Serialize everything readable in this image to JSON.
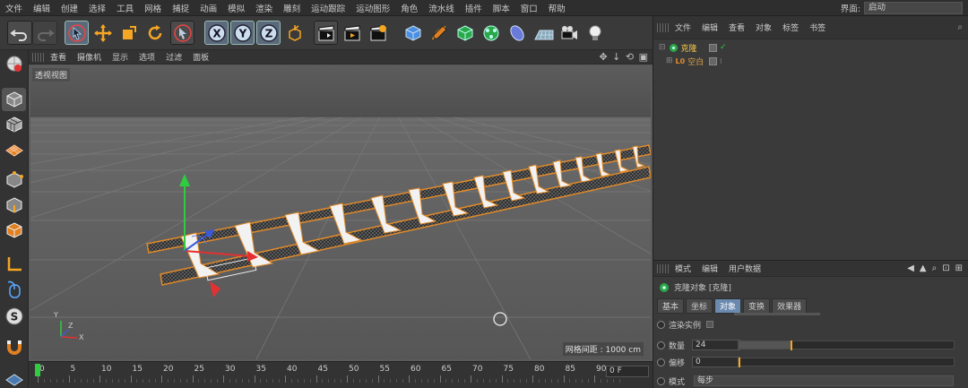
{
  "menu": {
    "items": [
      "文件",
      "编辑",
      "创建",
      "选择",
      "工具",
      "网格",
      "捕捉",
      "动画",
      "模拟",
      "渲染",
      "雕刻",
      "运动跟踪",
      "运动图形",
      "角色",
      "流水线",
      "插件",
      "脚本",
      "窗口",
      "帮助"
    ],
    "layout_label": "界面:",
    "layout_value": "启动"
  },
  "viewport": {
    "menu": [
      "查看",
      "摄像机",
      "显示",
      "选项",
      "过滤",
      "面板"
    ],
    "nav_icons": "✥ ↓ ⟲ ▣",
    "label": "透视视图",
    "grid_spacing": "网格间距 : 1000 cm",
    "axis_x": "X",
    "axis_y": "Y",
    "axis_z": "Z"
  },
  "timeline": {
    "ticks": [
      "0",
      "5",
      "10",
      "15",
      "20",
      "25",
      "30",
      "35",
      "40",
      "45",
      "50",
      "55",
      "60",
      "65",
      "70",
      "75",
      "80",
      "85",
      "90"
    ],
    "frame": "0 F"
  },
  "object_manager": {
    "menu": [
      "文件",
      "编辑",
      "查看",
      "对象",
      "标签",
      "书签"
    ],
    "objects": [
      {
        "name": "克隆",
        "color": "#f5c84a"
      },
      {
        "name": "空白",
        "color": "#d6a24a"
      }
    ]
  },
  "attribute_manager": {
    "menu": [
      "模式",
      "编辑",
      "用户数据"
    ],
    "title": "克隆对象 [克隆]",
    "tabs": [
      "基本",
      "坐标",
      "对象",
      "变换",
      "效果器"
    ],
    "active_tab": 2,
    "params": {
      "render_instances": "渲染实例",
      "count_label": "数量",
      "count_value": "24",
      "offset_label": "偏移",
      "offset_value": "0",
      "mode_label": "模式",
      "mode_value": "每步"
    }
  },
  "colors": {
    "accent": "#6b8ab0",
    "selection": "#f5a623"
  }
}
